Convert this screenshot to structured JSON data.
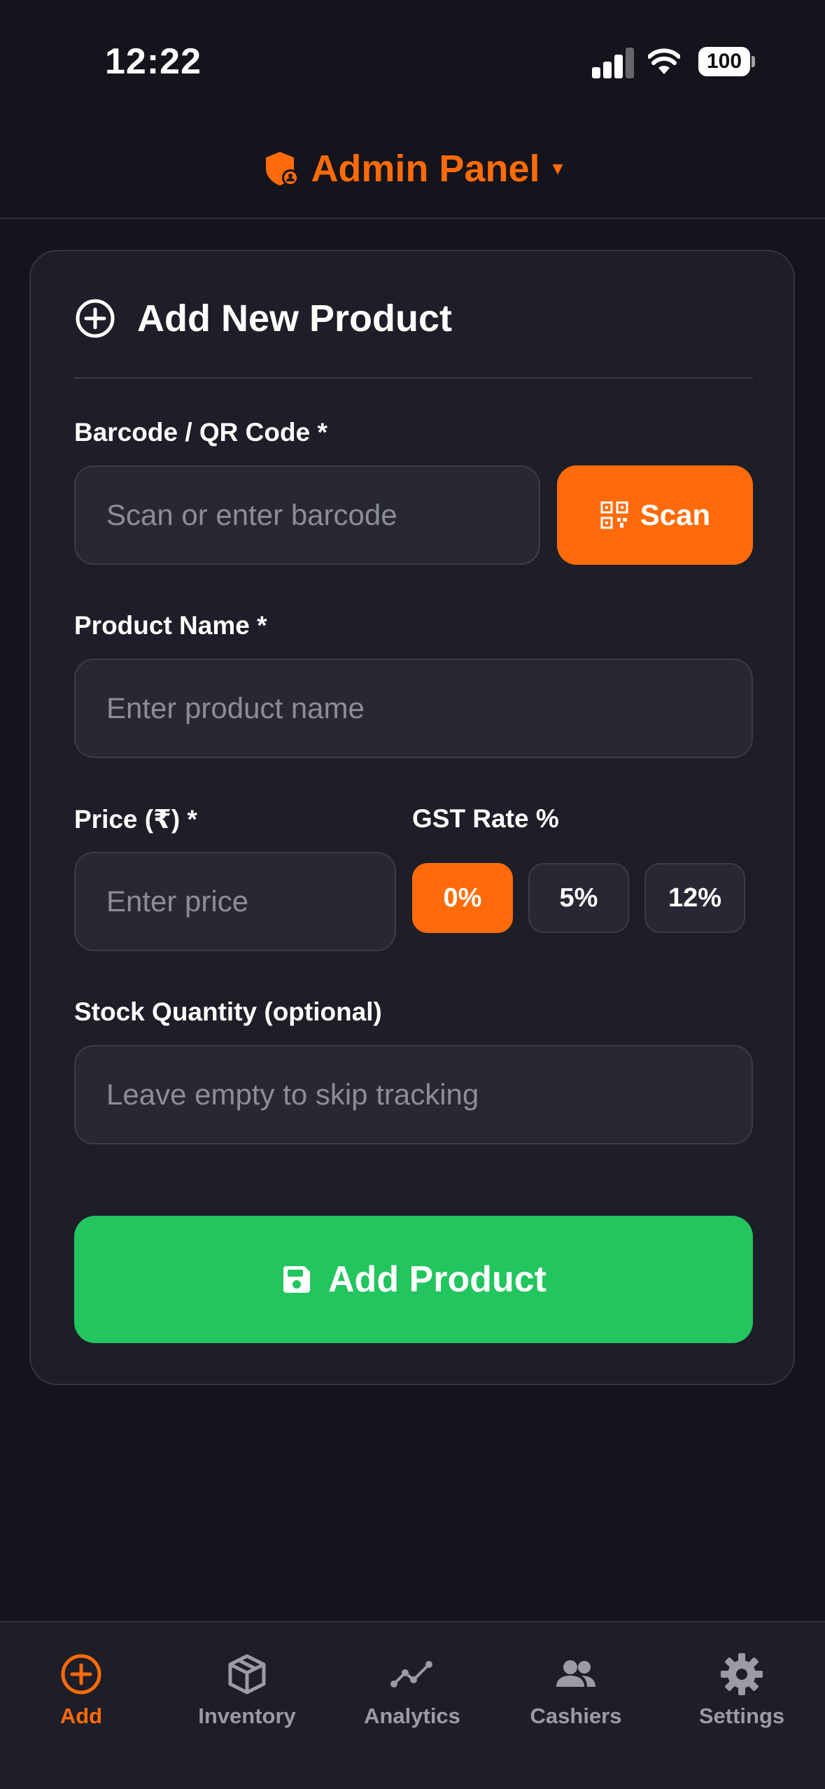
{
  "status_bar": {
    "time": "12:22",
    "battery": "100"
  },
  "header": {
    "title": "Admin Panel",
    "caret": "▾"
  },
  "form": {
    "title": "Add New Product",
    "barcode": {
      "label": "Barcode / QR Code *",
      "placeholder": "Scan or enter barcode",
      "value": ""
    },
    "scan_button": "Scan",
    "product_name": {
      "label": "Product Name *",
      "placeholder": "Enter product name",
      "value": ""
    },
    "price": {
      "label": "Price (₹) *",
      "placeholder": "Enter price",
      "value": ""
    },
    "gst": {
      "label": "GST Rate %",
      "options": [
        "0%",
        "5%",
        "12%"
      ],
      "selected": "0%"
    },
    "stock": {
      "label": "Stock Quantity (optional)",
      "placeholder": "Leave empty to skip tracking",
      "value": ""
    },
    "submit_button": "Add Product"
  },
  "nav": {
    "items": [
      {
        "label": "Add",
        "icon": "plus-circle-icon",
        "active": true
      },
      {
        "label": "Inventory",
        "icon": "box-icon",
        "active": false
      },
      {
        "label": "Analytics",
        "icon": "chart-line-icon",
        "active": false
      },
      {
        "label": "Cashiers",
        "icon": "users-icon",
        "active": false
      },
      {
        "label": "Settings",
        "icon": "gear-icon",
        "active": false
      }
    ]
  },
  "colors": {
    "accent": "#ff6b0a",
    "success": "#22c55e",
    "background": "#14141c",
    "card": "#1d1e27"
  }
}
